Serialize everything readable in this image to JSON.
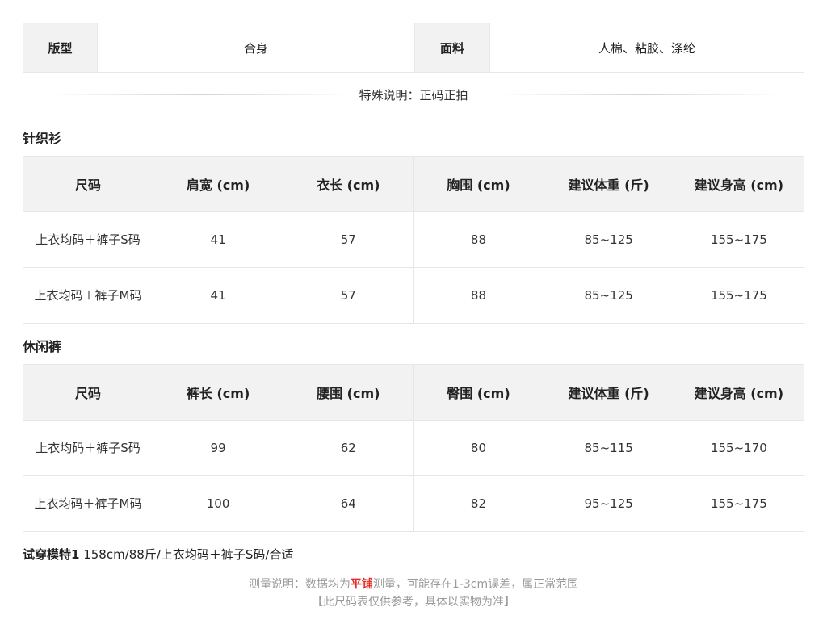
{
  "spec": {
    "fit_label": "版型",
    "fit_value": "合身",
    "fabric_label": "面料",
    "fabric_value": "人棉、粘胶、涤纶"
  },
  "special_note": "特殊说明：正码正拍",
  "knit": {
    "title": "针织衫",
    "headers": [
      "尺码",
      "肩宽 (cm)",
      "衣长 (cm)",
      "胸围 (cm)",
      "建议体重 (斤)",
      "建议身高 (cm)"
    ],
    "rows": [
      [
        "上衣均码＋裤子S码",
        "41",
        "57",
        "88",
        "85~125",
        "155~175"
      ],
      [
        "上衣均码＋裤子M码",
        "41",
        "57",
        "88",
        "85~125",
        "155~175"
      ]
    ]
  },
  "pants": {
    "title": "休闲裤",
    "headers": [
      "尺码",
      "裤长 (cm)",
      "腰围 (cm)",
      "臀围 (cm)",
      "建议体重 (斤)",
      "建议身高 (cm)"
    ],
    "rows": [
      [
        "上衣均码＋裤子S码",
        "99",
        "62",
        "80",
        "85~115",
        "155~170"
      ],
      [
        "上衣均码＋裤子M码",
        "100",
        "64",
        "82",
        "95~125",
        "155~175"
      ]
    ]
  },
  "model": {
    "label": "试穿模特1",
    "info": " 158cm/88斤/上衣均码＋裤子S码/合适"
  },
  "measure_note": {
    "prefix": "测量说明：数据均为",
    "highlight": "平铺",
    "suffix": "测量，可能存在1-3cm误差，属正常范围"
  },
  "disclaimer": "【此尺码表仅供参考，具体以实物为准】"
}
